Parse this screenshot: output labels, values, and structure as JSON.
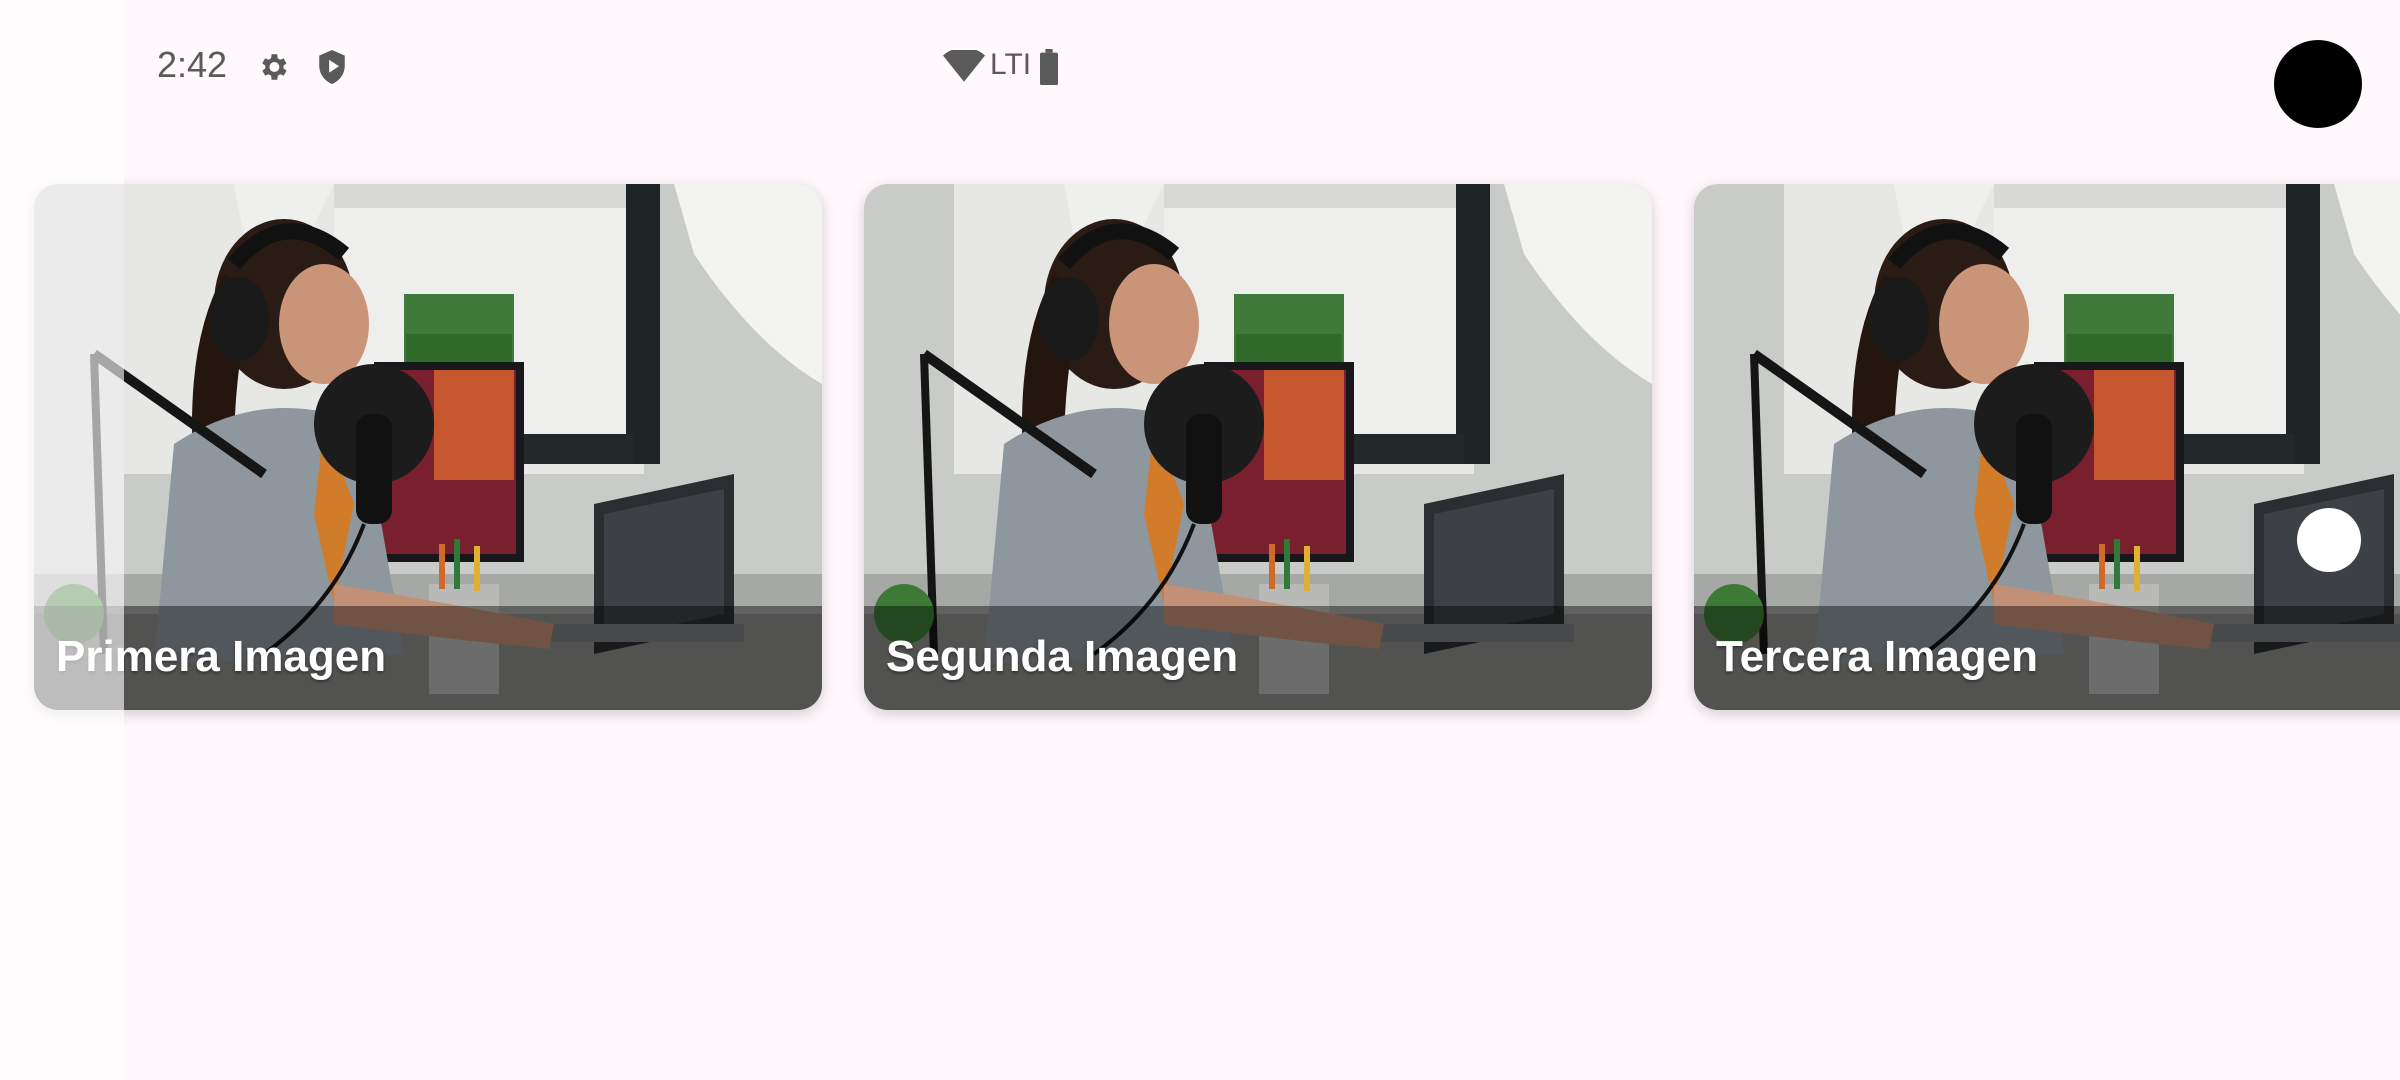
{
  "status_bar": {
    "time": "2:42",
    "network_label": "LTI",
    "icons": [
      "gear-icon",
      "shield-play-icon",
      "wifi-icon",
      "battery-icon"
    ]
  },
  "carousel": {
    "items": [
      {
        "caption": "Primera Imagen",
        "image": "podcast-woman-headphones-microphone"
      },
      {
        "caption": "Segunda Imagen",
        "image": "podcast-woman-headphones-microphone"
      },
      {
        "caption": "Tercera Imagen",
        "image": "podcast-woman-headphones-microphone"
      }
    ]
  },
  "colors": {
    "background": "#fff8fc",
    "caption_text": "#ffffff",
    "status_text": "#5a5a5a"
  }
}
